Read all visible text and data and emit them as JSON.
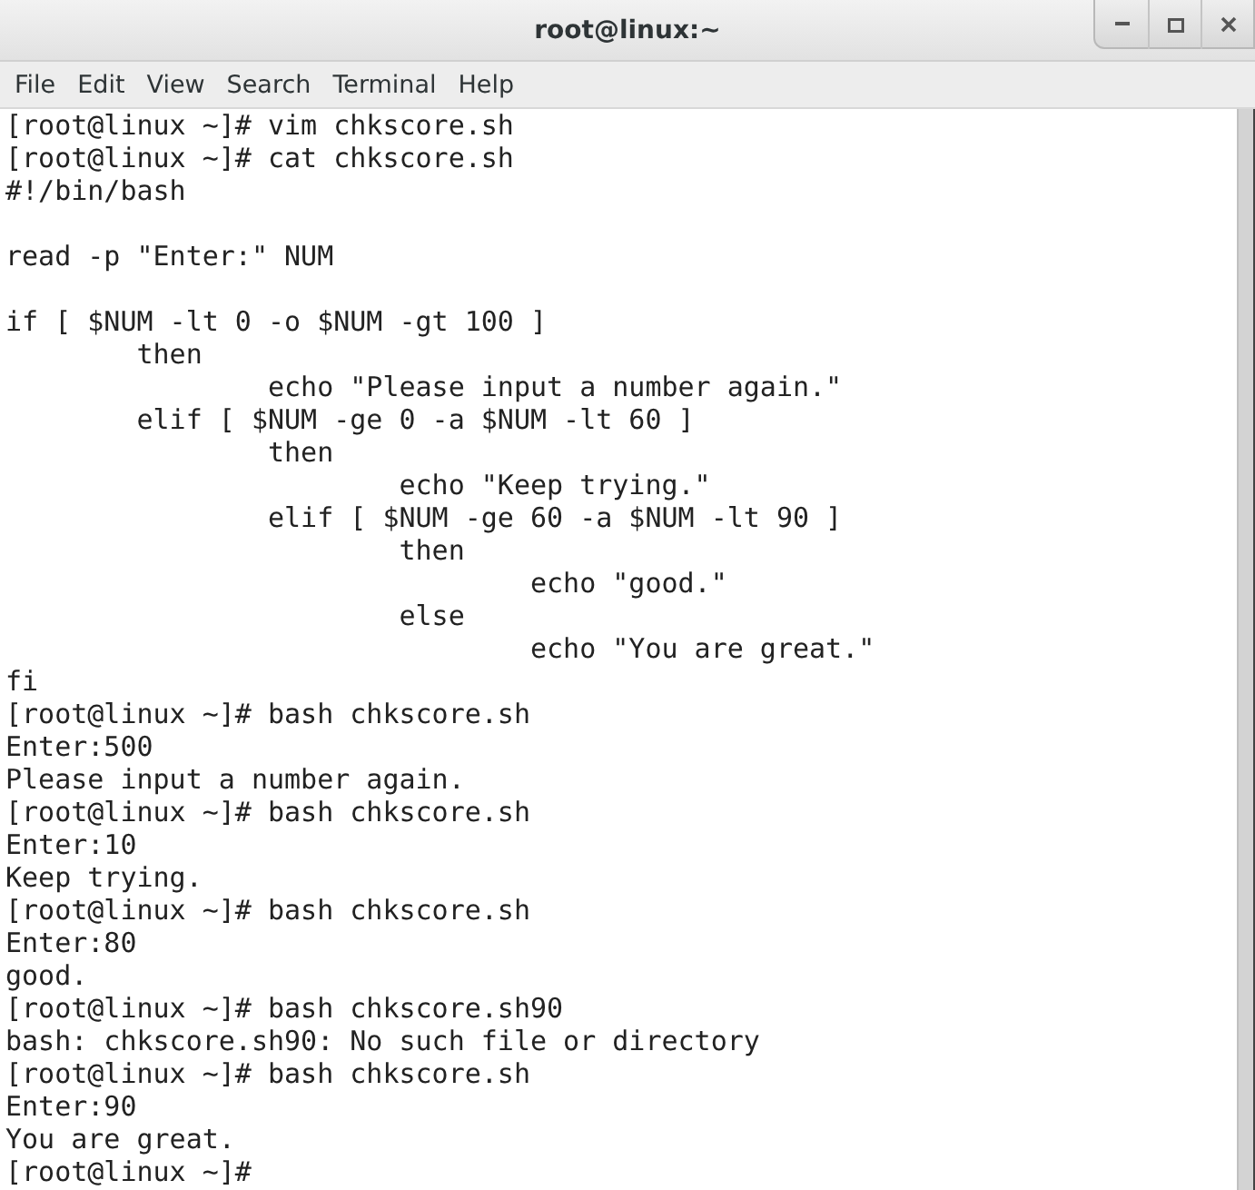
{
  "window": {
    "title": "root@linux:~"
  },
  "menu": [
    "File",
    "Edit",
    "View",
    "Search",
    "Terminal",
    "Help"
  ],
  "terminal": {
    "blocks": [
      [
        "[root@linux ~]# vim chkscore.sh",
        "[root@linux ~]# cat chkscore.sh",
        "#!/bin/bash"
      ],
      [
        "read -p \"Enter:\" NUM"
      ],
      [
        "if [ $NUM -lt 0 -o $NUM -gt 100 ]",
        "        then",
        "                echo \"Please input a number again.\"",
        "        elif [ $NUM -ge 0 -a $NUM -lt 60 ]",
        "                then",
        "                        echo \"Keep trying.\"",
        "                elif [ $NUM -ge 60 -a $NUM -lt 90 ]",
        "                        then",
        "                                echo \"good.\"",
        "                        else",
        "                                echo \"You are great.\"",
        "fi",
        "[root@linux ~]# bash chkscore.sh",
        "Enter:500",
        "Please input a number again.",
        "[root@linux ~]# bash chkscore.sh",
        "Enter:10",
        "Keep trying.",
        "[root@linux ~]# bash chkscore.sh",
        "Enter:80",
        "good.",
        "[root@linux ~]# bash chkscore.sh90",
        "bash: chkscore.sh90: No such file or directory",
        "[root@linux ~]# bash chkscore.sh",
        "Enter:90",
        "You are great.",
        "[root@linux ~]#"
      ]
    ]
  }
}
